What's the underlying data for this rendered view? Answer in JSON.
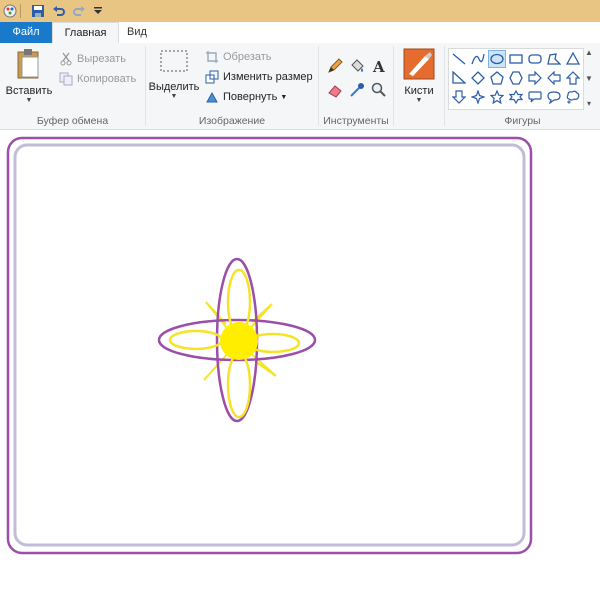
{
  "tabs": {
    "file": "Файл",
    "home": "Главная",
    "view": "Вид"
  },
  "clipboard": {
    "paste": "Вставить",
    "cut": "Вырезать",
    "copy": "Копировать",
    "group_label": "Буфер обмена"
  },
  "image": {
    "select": "Выделить",
    "crop": "Обрезать",
    "resize": "Изменить размер",
    "rotate": "Повернуть",
    "group_label": "Изображение"
  },
  "tools": {
    "group_label": "Инструменты",
    "icons": [
      "pencil-icon",
      "fill-icon",
      "text-icon",
      "eraser-icon",
      "color-picker-icon",
      "magnifier-icon"
    ]
  },
  "brushes": {
    "label": "Кисти"
  },
  "shapes": {
    "group_label": "Фигуры",
    "selected": "oval"
  },
  "colors": {
    "accent": "#1979ca",
    "outline": "#9b4fa9",
    "petal": "#f5e32a",
    "center": "#ffee00",
    "frame_inner": "#c1bcd8"
  }
}
